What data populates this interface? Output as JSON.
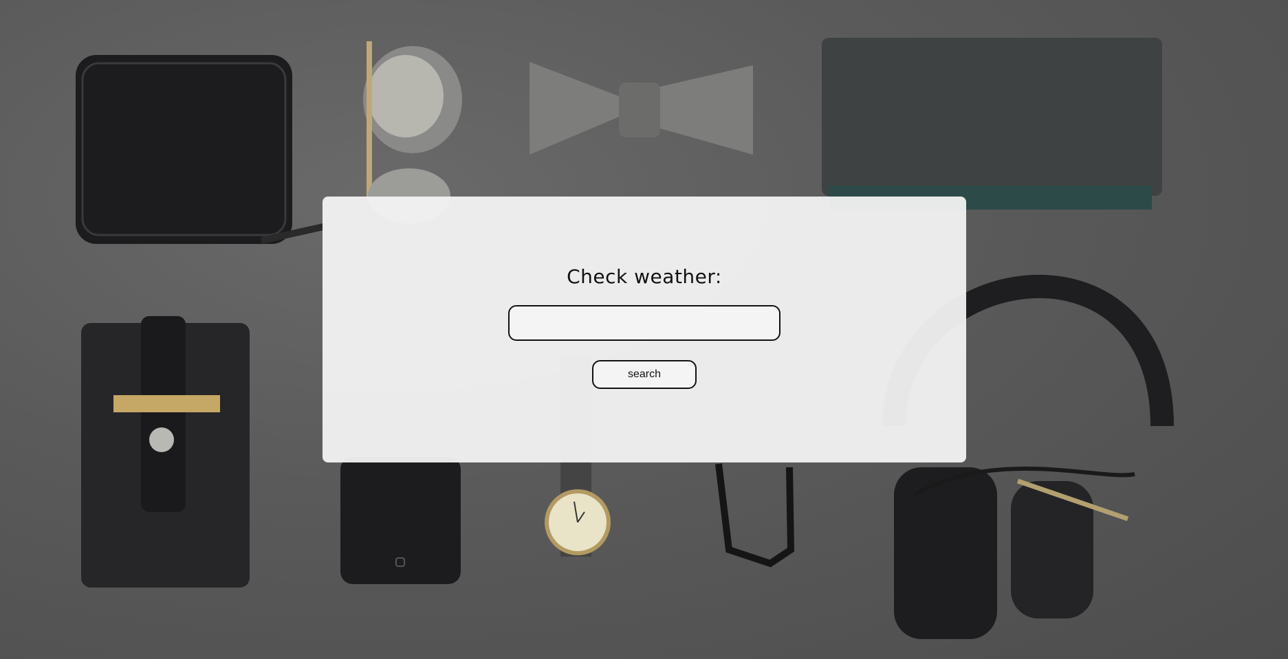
{
  "background": {
    "description_icon": "flatlay-accessories-photo",
    "base_color": "#5b5b5b"
  },
  "weather_form": {
    "title": "Check weather:",
    "input_value": "",
    "input_placeholder": "",
    "search_label": "search"
  }
}
